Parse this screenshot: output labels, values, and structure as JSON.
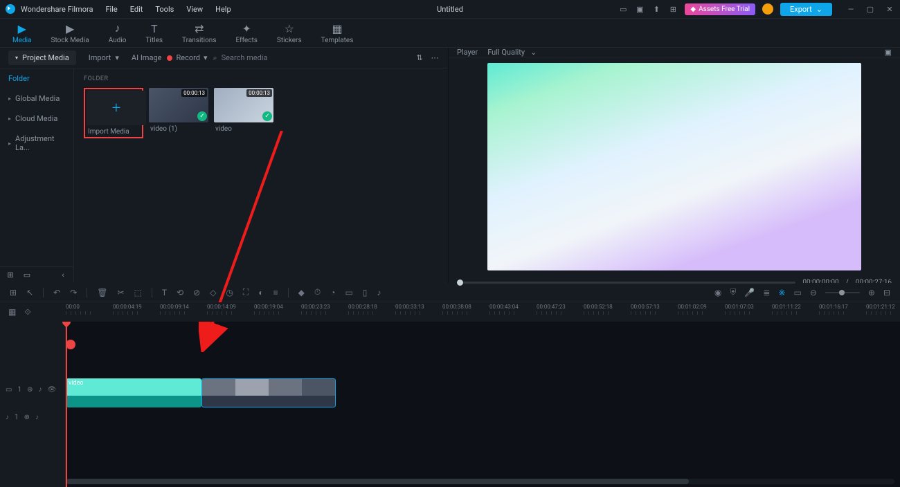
{
  "app": {
    "name": "Wondershare Filmora",
    "document": "Untitled"
  },
  "menu": [
    "File",
    "Edit",
    "Tools",
    "View",
    "Help"
  ],
  "titlebar": {
    "assets": "Assets Free Trial",
    "export": "Export"
  },
  "tabs": [
    {
      "id": "media",
      "label": "Media",
      "active": true
    },
    {
      "id": "stock",
      "label": "Stock Media"
    },
    {
      "id": "audio",
      "label": "Audio"
    },
    {
      "id": "titles",
      "label": "Titles"
    },
    {
      "id": "transitions",
      "label": "Transitions"
    },
    {
      "id": "effects",
      "label": "Effects"
    },
    {
      "id": "stickers",
      "label": "Stickers"
    },
    {
      "id": "templates",
      "label": "Templates"
    }
  ],
  "mediaToolbar": {
    "projectMedia": "Project Media",
    "import": "Import",
    "aiImage": "AI Image",
    "record": "Record",
    "searchPlaceholder": "Search media"
  },
  "sidebar": {
    "folder": "Folder",
    "items": [
      "Global Media",
      "Cloud Media",
      "Adjustment La..."
    ]
  },
  "content": {
    "folderLabel": "FOLDER",
    "importMedia": "Import Media",
    "clips": [
      {
        "name": "video (1)",
        "duration": "00:00:13"
      },
      {
        "name": "video",
        "duration": "00:00:13"
      }
    ]
  },
  "player": {
    "label": "Player",
    "quality": "Full Quality",
    "current": "00:00:00:00",
    "total": "00:00:27:16",
    "sep": "/"
  },
  "ruler": [
    "00:00",
    "00:00:04:19",
    "00:00:09:14",
    "00:00:14:09",
    "00:00:19:04",
    "00:00:23:23",
    "00:00:28:18",
    "00:00:33:13",
    "00:00:38:08",
    "00:00:43:04",
    "00:00:47:23",
    "00:00:52:18",
    "00:00:57:13",
    "00:01:02:09",
    "00:01:07:03",
    "00:01:11:22",
    "00:01:16:17",
    "00:01:21:12"
  ],
  "tracks": {
    "video": "1",
    "audio": "1",
    "clip1Label": "video",
    "clip2Label": ""
  }
}
